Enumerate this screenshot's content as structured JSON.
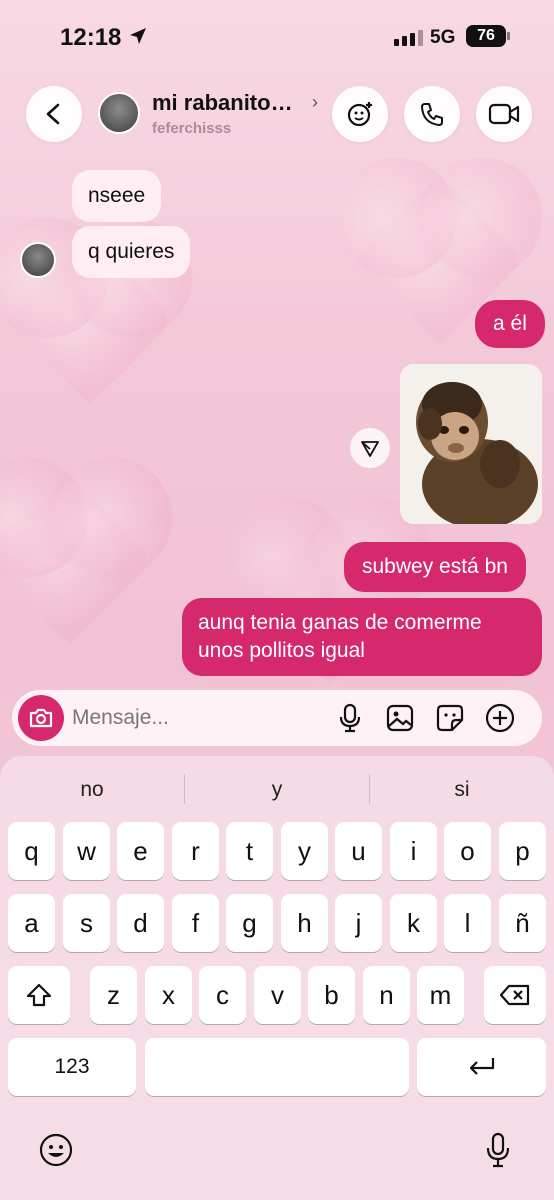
{
  "status_bar": {
    "time": "12:18",
    "network": "5G",
    "battery": "76"
  },
  "header": {
    "contact_name": "mi rabanito…",
    "username": "feferchisss",
    "icons": [
      "back-icon",
      "effects-icon",
      "phone-icon",
      "video-icon"
    ]
  },
  "messages": {
    "incoming": [
      "nseee",
      "q quieres"
    ],
    "outgoing_1": "a él",
    "outgoing_2": "subwey está bn",
    "outgoing_3_line1": "aunq tenia ganas de comerme",
    "outgoing_3_line2": "unos pollitos igual"
  },
  "composer": {
    "placeholder": "Mensaje...",
    "icons": [
      "camera-icon",
      "microphone-icon",
      "gallery-icon",
      "sticker-icon",
      "plus-icon"
    ]
  },
  "keyboard": {
    "suggestions": [
      "no",
      "y",
      "si"
    ],
    "row1": [
      "q",
      "w",
      "e",
      "r",
      "t",
      "y",
      "u",
      "i",
      "o",
      "p"
    ],
    "row2": [
      "a",
      "s",
      "d",
      "f",
      "g",
      "h",
      "j",
      "k",
      "l",
      "ñ"
    ],
    "row3": [
      "z",
      "x",
      "c",
      "v",
      "b",
      "n",
      "m"
    ],
    "numbers_key": "123"
  },
  "colors": {
    "accent": "#d6296d",
    "background": "#f3c8d8"
  }
}
